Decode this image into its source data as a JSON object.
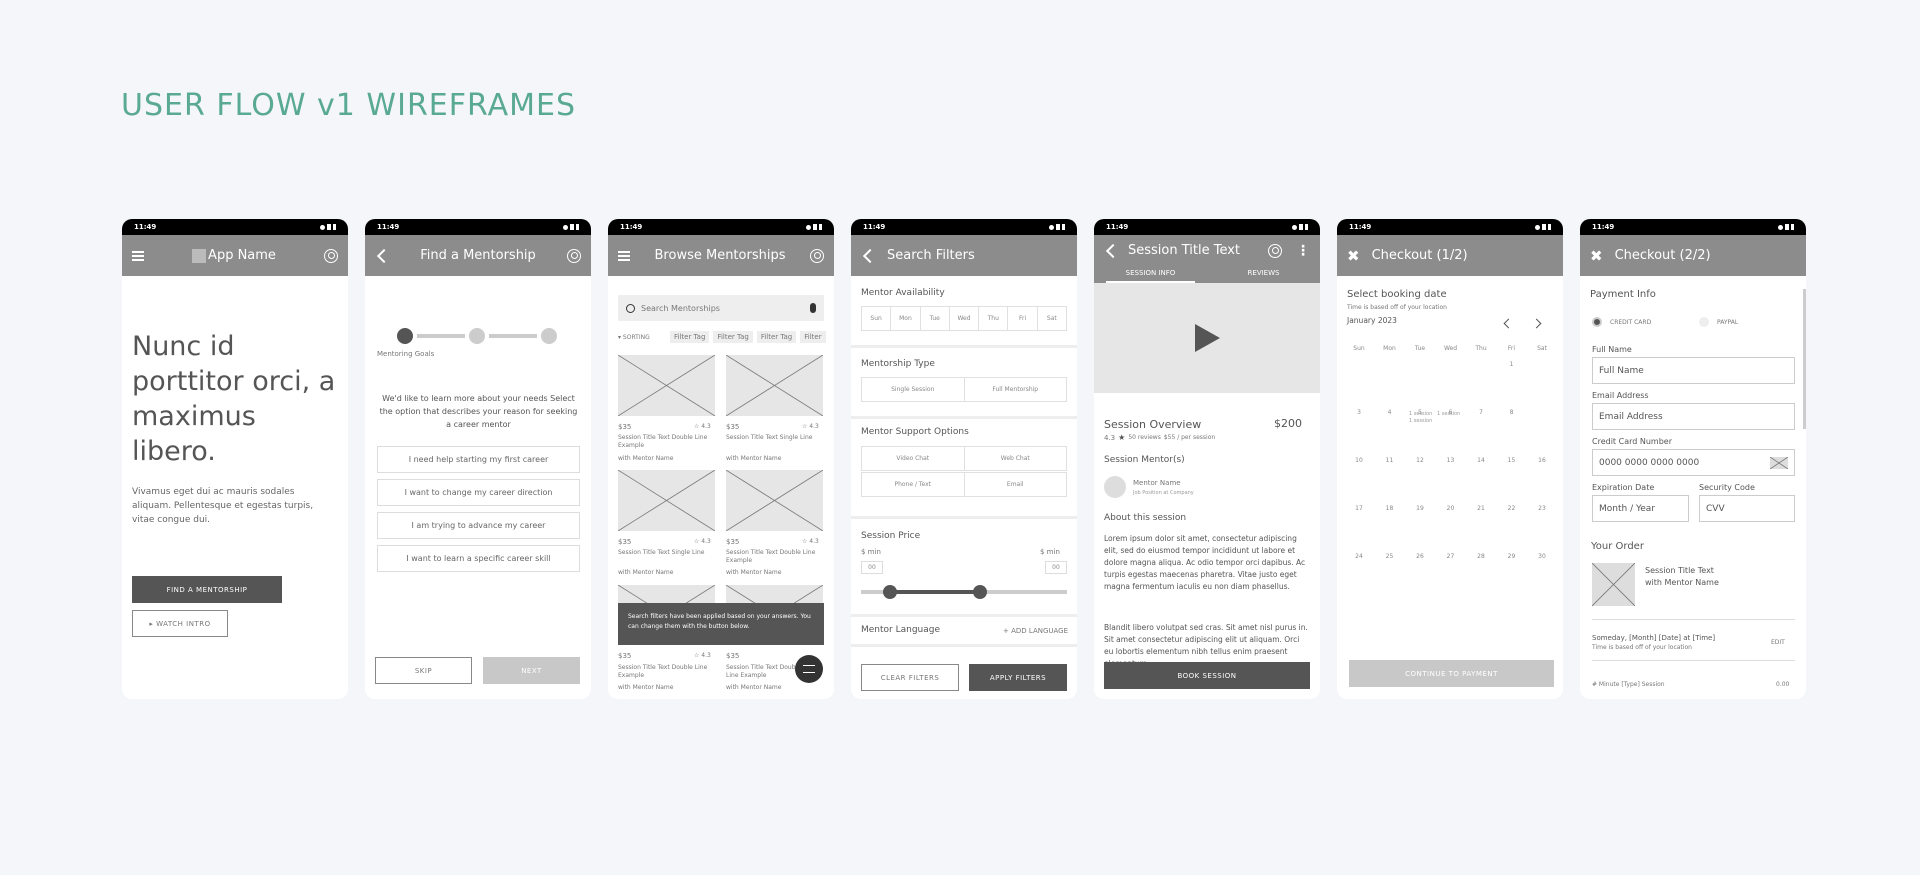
{
  "page_title": "USER FLOW v1 WIREFRAMES",
  "status_time": "11:49",
  "screen1": {
    "app_name": "App Name",
    "headline": "Nunc id porttitor orci, a maximus libero.",
    "body": "Vivamus eget dui ac mauris sodales aliquam. Pellentesque et egestas turpis, vitae congue dui.",
    "primary_btn": "FIND A MENTORSHIP",
    "secondary_btn": "▸ WATCH INTRO"
  },
  "screen2": {
    "title": "Find a Mentorship",
    "step_label": "Mentoring Goals",
    "intro": "We'd like to learn more about your needs Select the option that describes your reason for seeking a career mentor",
    "options": [
      "I need help starting my first career",
      "I want to change my career direction",
      "I am trying to advance my career",
      "I want to learn a specific career skill"
    ],
    "skip": "SKIP",
    "next": "NEXT"
  },
  "screen3": {
    "title": "Browse Mentorships",
    "search_placeholder": "Search Mentorships",
    "sorting": "▾ SORTING",
    "tags": [
      "Filter Tag",
      "Filter Tag",
      "Filter Tag",
      "Filter"
    ],
    "cards": [
      {
        "price": "$35",
        "rating": "☆ 4.3",
        "title": "Session Title Text Double Line Example",
        "mentor": "with Mentor Name"
      },
      {
        "price": "$35",
        "rating": "☆ 4.3",
        "title": "Session Title Text Single Line",
        "mentor": "with Mentor Name"
      },
      {
        "price": "$35",
        "rating": "☆ 4.3",
        "title": "Session Title Text Single Line",
        "mentor": "with Mentor Name"
      },
      {
        "price": "$35",
        "rating": "☆ 4.3",
        "title": "Session Title Text Double Line Example",
        "mentor": "with Mentor Name"
      },
      {
        "price": "$35",
        "rating": "☆ 4.3",
        "title": "Session Title Text Double Line Example",
        "mentor": "with Mentor Name"
      },
      {
        "price": "$35",
        "rating": "☆ 4.3",
        "title": "Session Title Text Double Line Example",
        "mentor": "with Mentor Name"
      }
    ],
    "toast": "Search filters have been applied based on your answers. You can change them with the button below."
  },
  "screen4": {
    "title": "Search Filters",
    "availability_label": "Mentor Availability",
    "days": [
      "Sun",
      "Mon",
      "Tue",
      "Wed",
      "Thu",
      "Fri",
      "Sat"
    ],
    "type_label": "Mentorship Type",
    "types": [
      "Single Session",
      "Full Mentorship"
    ],
    "support_label": "Mentor Support Options",
    "supports": [
      "Video Chat",
      "Web Chat",
      "Phone / Text",
      "Email"
    ],
    "price_label": "Session Price",
    "min_label": "$ min",
    "max_label": "$ min",
    "min_val": "00",
    "max_val": "00",
    "price_low_pct": 14,
    "price_high_pct": 58,
    "language_label": "Mentor Language",
    "add_language": "+ ADD LANGUAGE",
    "clear": "CLEAR FILTERS",
    "apply": "APPLY FILTERS"
  },
  "screen5": {
    "title": "Session Title Text",
    "tabs": [
      "SESSION INFO",
      "REVIEWS"
    ],
    "overview": "Session Overview",
    "price": "$200",
    "rating": "4.3",
    "reviews": "50 reviews",
    "per_session": "$55 / per session",
    "mentors_label": "Session Mentor(s)",
    "mentor_name": "Mentor Name",
    "mentor_job": "Job Position at Company",
    "about_label": "About this session",
    "about_p1": "Lorem ipsum dolor sit amet, consectetur adipiscing elit, sed do eiusmod tempor incididunt ut labore et dolore magna aliqua. Ac odio tempor orci dapibus. Ac turpis egestas maecenas pharetra. Vitae justo eget magna fermentum iaculis eu non diam phasellus.",
    "about_p2": "Blandit libero volutpat sed cras. Sit amet nisl purus in. Sit amet consectetur adipiscing elit ut aliquam. Orci eu lobortis elementum nibh tellus enim praesent elementum.",
    "book": "BOOK SESSION"
  },
  "screen6": {
    "title": "Checkout (1/2)",
    "select_label": "Select booking date",
    "note": "Time is based off of your location",
    "month": "January 2023",
    "weekdays": [
      "Sun",
      "Mon",
      "Tue",
      "Wed",
      "Thu",
      "Fri",
      "Sat"
    ],
    "rows": [
      [
        "",
        "",
        "",
        "",
        "",
        "1",
        ""
      ],
      [
        "3",
        "4",
        "5",
        "6",
        "7",
        "8",
        ""
      ],
      [
        "10",
        "11",
        "12",
        "13",
        "14",
        "15",
        "16"
      ],
      [
        "17",
        "18",
        "19",
        "20",
        "21",
        "22",
        "23"
      ],
      [
        "24",
        "25",
        "26",
        "27",
        "28",
        "29",
        "30"
      ]
    ],
    "slot_note": "1 session",
    "continue": "CONTINUE TO PAYMENT"
  },
  "screen7": {
    "title": "Checkout (2/2)",
    "payment_label": "Payment Info",
    "credit": "CREDIT CARD",
    "paypal": "PAYPAL",
    "full_name_label": "Full Name",
    "full_name_placeholder": "Full Name",
    "email_label": "Email Address",
    "email_placeholder": "Email Address",
    "cc_label": "Credit Card Number",
    "cc_placeholder": "0000 0000 0000 0000",
    "exp_label": "Expiration Date",
    "exp_placeholder": "Month / Year",
    "cvv_label": "Security Code",
    "cvv_placeholder": "CVV",
    "order_label": "Your Order",
    "order_title": "Session Title Text",
    "order_mentor": "with Mentor Name",
    "when": "Someday, [Month] [Date] at [Time]",
    "when_note": "Time is based off of your location",
    "edit": "EDIT",
    "line_item": "# Minute [Type] Session",
    "line_price": "0.00"
  }
}
